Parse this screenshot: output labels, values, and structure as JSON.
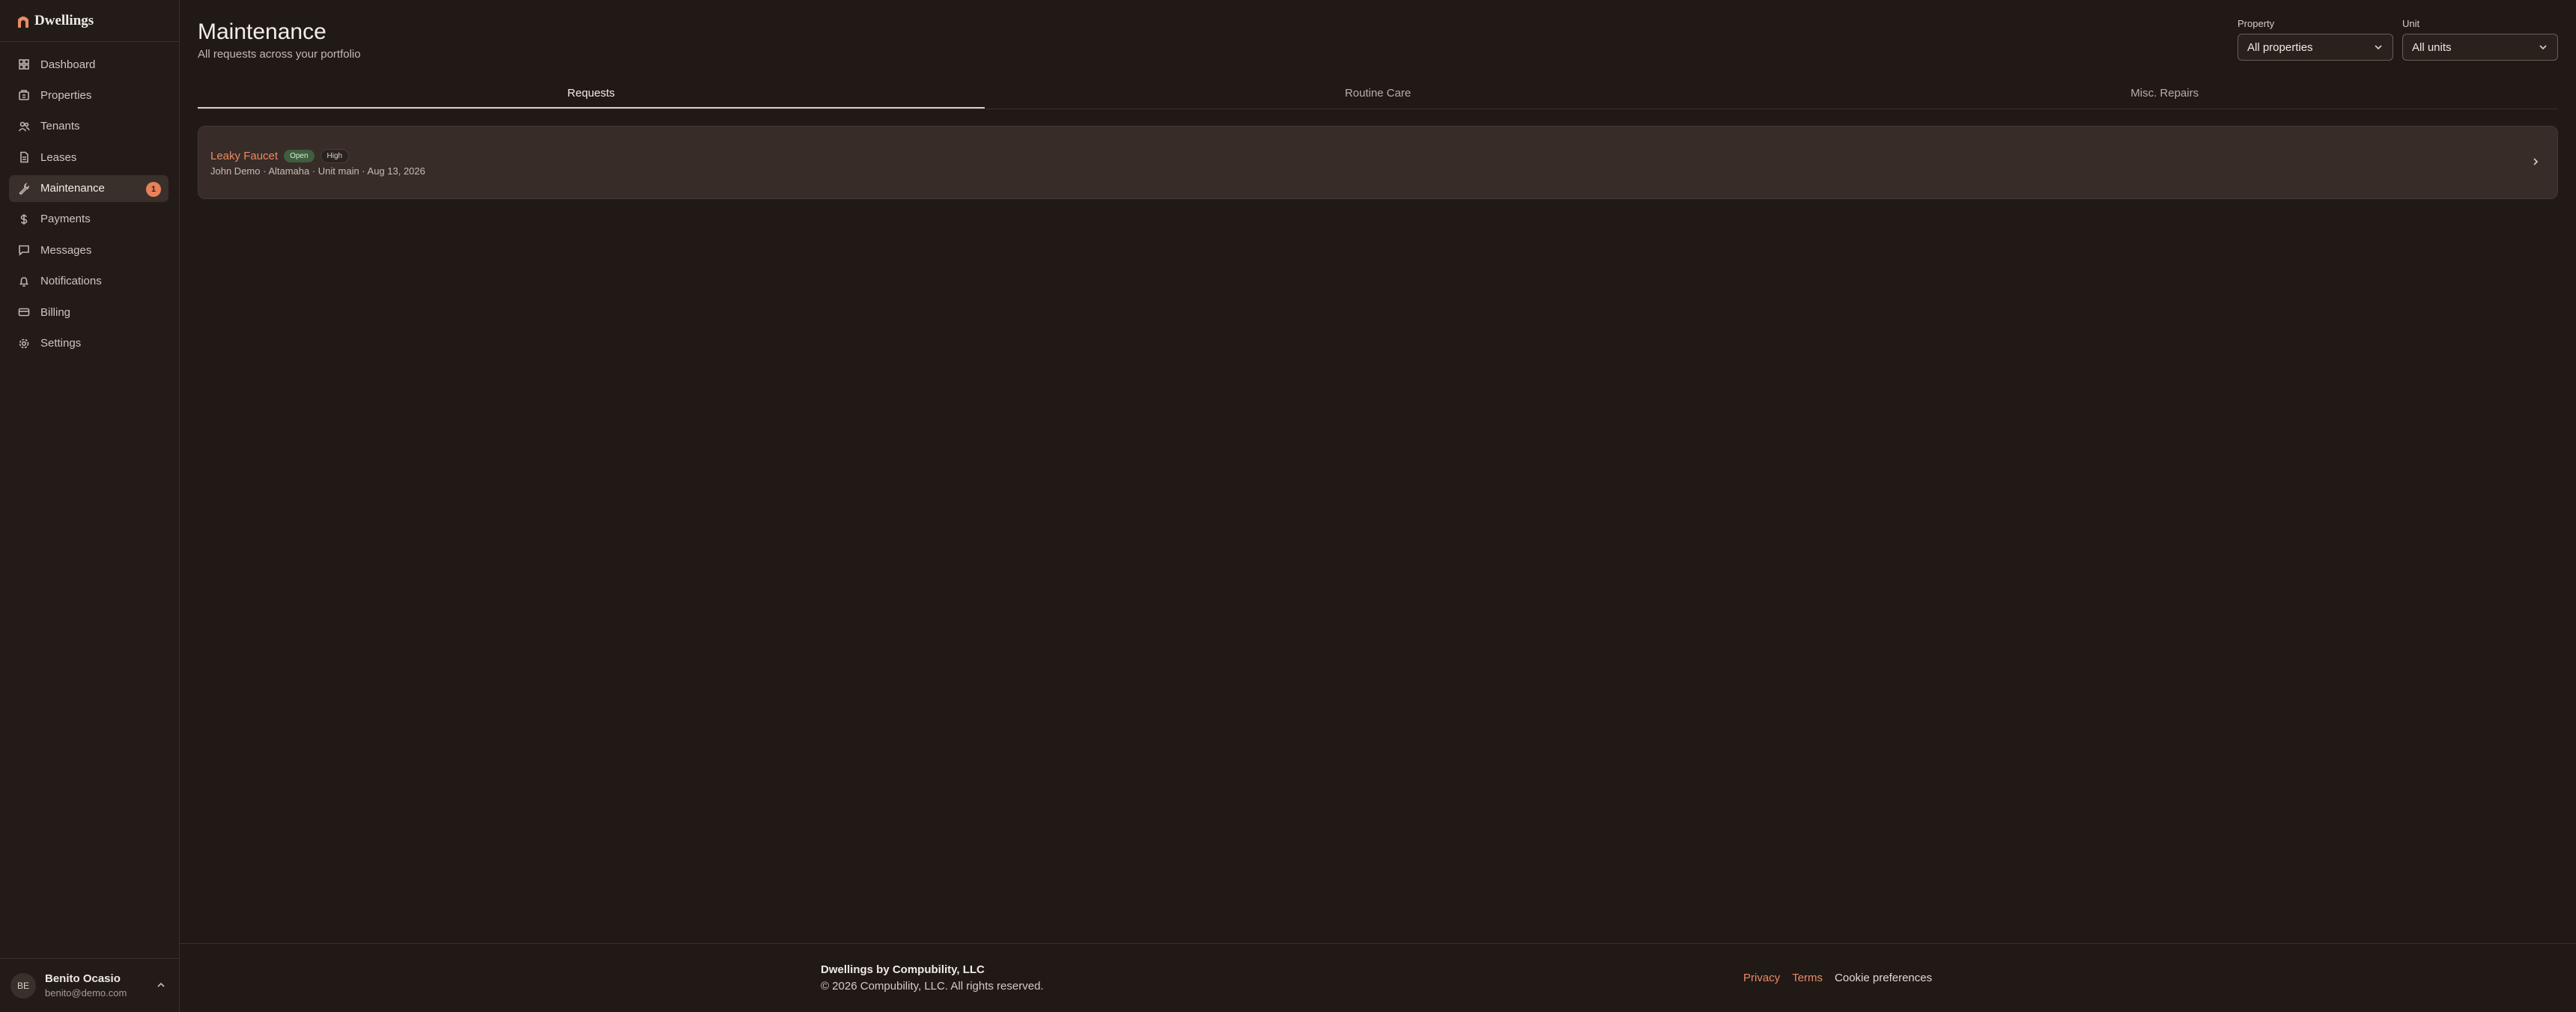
{
  "brand": {
    "name": "Dwellings",
    "accent": "#e98c64"
  },
  "sidebar": {
    "items": [
      {
        "label": "Dashboard",
        "icon": "layout-grid-icon"
      },
      {
        "label": "Properties",
        "icon": "building-icon"
      },
      {
        "label": "Tenants",
        "icon": "users-icon"
      },
      {
        "label": "Leases",
        "icon": "file-icon"
      },
      {
        "label": "Maintenance",
        "icon": "wrench-icon",
        "badge": "1",
        "active": true
      },
      {
        "label": "Payments",
        "icon": "dollar-icon"
      },
      {
        "label": "Messages",
        "icon": "message-icon"
      },
      {
        "label": "Notifications",
        "icon": "bell-icon"
      },
      {
        "label": "Billing",
        "icon": "credit-card-icon"
      },
      {
        "label": "Settings",
        "icon": "gear-icon"
      }
    ]
  },
  "user": {
    "initials": "BE",
    "name": "Benito Ocasio",
    "email": "benito@demo.com"
  },
  "header": {
    "title": "Maintenance",
    "subtitle": "All requests across your portfolio"
  },
  "filters": {
    "property": {
      "label": "Property",
      "value": "All properties"
    },
    "unit": {
      "label": "Unit",
      "value": "All units"
    }
  },
  "tabs": [
    {
      "label": "Requests",
      "active": true
    },
    {
      "label": "Routine Care"
    },
    {
      "label": "Misc. Repairs"
    }
  ],
  "requests": [
    {
      "title": "Leaky Faucet",
      "status": "Open",
      "priority": "High",
      "meta": "John Demo · Altamaha · Unit main · Aug 13, 2026"
    }
  ],
  "footer": {
    "company": "Dwellings by Compubility, LLC",
    "copyright": "© 2026 Compubility, LLC. All rights reserved.",
    "privacy": "Privacy",
    "terms": "Terms",
    "cookies": "Cookie preferences"
  }
}
